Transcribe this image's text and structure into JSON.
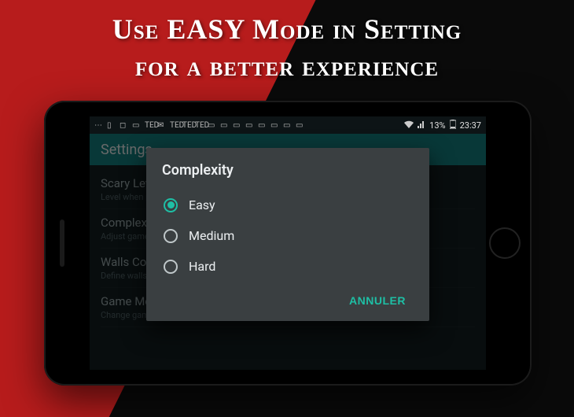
{
  "headline": {
    "line1": "Use EASY Mode in Setting",
    "line2": "for a better experience"
  },
  "statusbar": {
    "battery_text": "13%",
    "time": "23:37"
  },
  "appbar": {
    "title": "Settings"
  },
  "settings_bg": {
    "items": [
      {
        "title": "Scary Level",
        "sub": "Level when playing"
      },
      {
        "title": "Complexity",
        "sub": "Adjust game difficulty"
      },
      {
        "title": "Walls Color",
        "sub": "Define walls color"
      },
      {
        "title": "Game Mode",
        "sub": "Change game mode"
      }
    ]
  },
  "dialog": {
    "title": "Complexity",
    "options": [
      {
        "label": "Easy",
        "checked": true
      },
      {
        "label": "Medium",
        "checked": false
      },
      {
        "label": "Hard",
        "checked": false
      }
    ],
    "cancel": "ANNULER"
  }
}
